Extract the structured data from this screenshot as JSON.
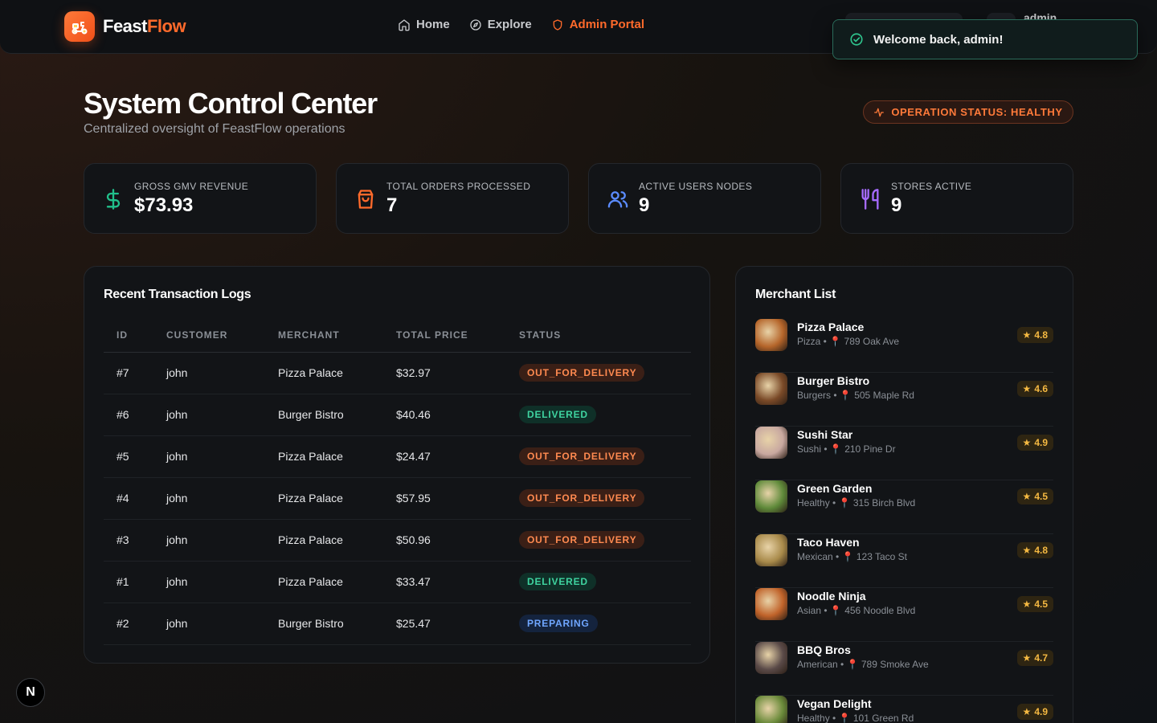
{
  "brand": {
    "name_a": "Feast",
    "name_b": "Flow",
    "icon": "scooter-icon"
  },
  "nav": [
    {
      "label": "Home",
      "icon": "home-icon"
    },
    {
      "label": "Explore",
      "icon": "compass-icon"
    },
    {
      "label": "Admin Portal",
      "icon": "shield-icon"
    }
  ],
  "header": {
    "user": "admin"
  },
  "toast": {
    "message": "Welcome back, admin!",
    "icon": "check-circle-icon"
  },
  "page": {
    "title": "System Control Center",
    "subtitle": "Centralized oversight of FeastFlow operations",
    "status": "OPERATION STATUS: HEALTHY"
  },
  "stats": [
    {
      "label": "GROSS GMV REVENUE",
      "value": "$73.93",
      "icon": "dollar-icon",
      "color": "#21c08b"
    },
    {
      "label": "TOTAL ORDERS PROCESSED",
      "value": "7",
      "icon": "bag-icon",
      "color": "#ff6a2b"
    },
    {
      "label": "ACTIVE USERS NODES",
      "value": "9",
      "icon": "users-icon",
      "color": "#5b8cff"
    },
    {
      "label": "STORES ACTIVE",
      "value": "9",
      "icon": "utensils-icon",
      "color": "#a66bff"
    }
  ],
  "transactions": {
    "title": "Recent Transaction Logs",
    "columns": [
      "ID",
      "CUSTOMER",
      "MERCHANT",
      "TOTAL PRICE",
      "STATUS"
    ],
    "rows": [
      {
        "id": "#7",
        "customer": "john",
        "merchant": "Pizza Palace",
        "price": "$32.97",
        "status": "OUT_FOR_DELIVERY"
      },
      {
        "id": "#6",
        "customer": "john",
        "merchant": "Burger Bistro",
        "price": "$40.46",
        "status": "DELIVERED"
      },
      {
        "id": "#5",
        "customer": "john",
        "merchant": "Pizza Palace",
        "price": "$24.47",
        "status": "OUT_FOR_DELIVERY"
      },
      {
        "id": "#4",
        "customer": "john",
        "merchant": "Pizza Palace",
        "price": "$57.95",
        "status": "OUT_FOR_DELIVERY"
      },
      {
        "id": "#3",
        "customer": "john",
        "merchant": "Pizza Palace",
        "price": "$50.96",
        "status": "OUT_FOR_DELIVERY"
      },
      {
        "id": "#1",
        "customer": "john",
        "merchant": "Pizza Palace",
        "price": "$33.47",
        "status": "DELIVERED"
      },
      {
        "id": "#2",
        "customer": "john",
        "merchant": "Burger Bistro",
        "price": "$25.47",
        "status": "PREPARING"
      }
    ]
  },
  "merchants": {
    "title": "Merchant List",
    "items": [
      {
        "name": "Pizza Palace",
        "cuisine": "Pizza",
        "address": "789 Oak Ave",
        "rating": "4.8",
        "thumb": "#b5652a"
      },
      {
        "name": "Burger Bistro",
        "cuisine": "Burgers",
        "address": "505 Maple Rd",
        "rating": "4.6",
        "thumb": "#7a4a28"
      },
      {
        "name": "Sushi Star",
        "cuisine": "Sushi",
        "address": "210 Pine Dr",
        "rating": "4.9",
        "thumb": "#c8a8a0"
      },
      {
        "name": "Green Garden",
        "cuisine": "Healthy",
        "address": "315 Birch Blvd",
        "rating": "4.5",
        "thumb": "#5f8a3a"
      },
      {
        "name": "Taco Haven",
        "cuisine": "Mexican",
        "address": "123 Taco St",
        "rating": "4.8",
        "thumb": "#a88a4a"
      },
      {
        "name": "Noodle Ninja",
        "cuisine": "Asian",
        "address": "456 Noodle Blvd",
        "rating": "4.5",
        "thumb": "#c0632a"
      },
      {
        "name": "BBQ Bros",
        "cuisine": "American",
        "address": "789 Smoke Ave",
        "rating": "4.7",
        "thumb": "#5a4a48"
      },
      {
        "name": "Vegan Delight",
        "cuisine": "Healthy",
        "address": "101 Green Rd",
        "rating": "4.9",
        "thumb": "#6a8a3a"
      }
    ]
  },
  "devtools": {
    "label": "N"
  }
}
